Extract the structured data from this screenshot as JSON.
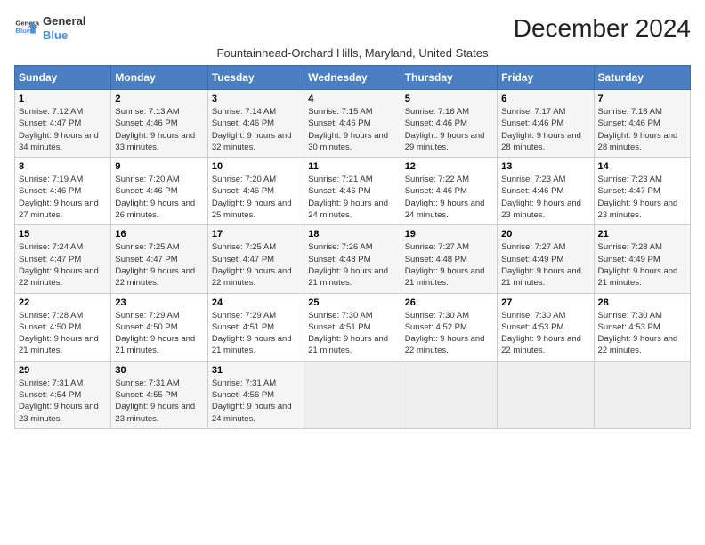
{
  "logo": {
    "line1": "General",
    "line2": "Blue",
    "icon_color": "#4a90d9"
  },
  "title": "December 2024",
  "subtitle": "Fountainhead-Orchard Hills, Maryland, United States",
  "columns": [
    "Sunday",
    "Monday",
    "Tuesday",
    "Wednesday",
    "Thursday",
    "Friday",
    "Saturday"
  ],
  "weeks": [
    [
      {
        "day": "1",
        "sunrise": "Sunrise: 7:12 AM",
        "sunset": "Sunset: 4:47 PM",
        "daylight": "Daylight: 9 hours and 34 minutes."
      },
      {
        "day": "2",
        "sunrise": "Sunrise: 7:13 AM",
        "sunset": "Sunset: 4:46 PM",
        "daylight": "Daylight: 9 hours and 33 minutes."
      },
      {
        "day": "3",
        "sunrise": "Sunrise: 7:14 AM",
        "sunset": "Sunset: 4:46 PM",
        "daylight": "Daylight: 9 hours and 32 minutes."
      },
      {
        "day": "4",
        "sunrise": "Sunrise: 7:15 AM",
        "sunset": "Sunset: 4:46 PM",
        "daylight": "Daylight: 9 hours and 30 minutes."
      },
      {
        "day": "5",
        "sunrise": "Sunrise: 7:16 AM",
        "sunset": "Sunset: 4:46 PM",
        "daylight": "Daylight: 9 hours and 29 minutes."
      },
      {
        "day": "6",
        "sunrise": "Sunrise: 7:17 AM",
        "sunset": "Sunset: 4:46 PM",
        "daylight": "Daylight: 9 hours and 28 minutes."
      },
      {
        "day": "7",
        "sunrise": "Sunrise: 7:18 AM",
        "sunset": "Sunset: 4:46 PM",
        "daylight": "Daylight: 9 hours and 28 minutes."
      }
    ],
    [
      {
        "day": "8",
        "sunrise": "Sunrise: 7:19 AM",
        "sunset": "Sunset: 4:46 PM",
        "daylight": "Daylight: 9 hours and 27 minutes."
      },
      {
        "day": "9",
        "sunrise": "Sunrise: 7:20 AM",
        "sunset": "Sunset: 4:46 PM",
        "daylight": "Daylight: 9 hours and 26 minutes."
      },
      {
        "day": "10",
        "sunrise": "Sunrise: 7:20 AM",
        "sunset": "Sunset: 4:46 PM",
        "daylight": "Daylight: 9 hours and 25 minutes."
      },
      {
        "day": "11",
        "sunrise": "Sunrise: 7:21 AM",
        "sunset": "Sunset: 4:46 PM",
        "daylight": "Daylight: 9 hours and 24 minutes."
      },
      {
        "day": "12",
        "sunrise": "Sunrise: 7:22 AM",
        "sunset": "Sunset: 4:46 PM",
        "daylight": "Daylight: 9 hours and 24 minutes."
      },
      {
        "day": "13",
        "sunrise": "Sunrise: 7:23 AM",
        "sunset": "Sunset: 4:46 PM",
        "daylight": "Daylight: 9 hours and 23 minutes."
      },
      {
        "day": "14",
        "sunrise": "Sunrise: 7:23 AM",
        "sunset": "Sunset: 4:47 PM",
        "daylight": "Daylight: 9 hours and 23 minutes."
      }
    ],
    [
      {
        "day": "15",
        "sunrise": "Sunrise: 7:24 AM",
        "sunset": "Sunset: 4:47 PM",
        "daylight": "Daylight: 9 hours and 22 minutes."
      },
      {
        "day": "16",
        "sunrise": "Sunrise: 7:25 AM",
        "sunset": "Sunset: 4:47 PM",
        "daylight": "Daylight: 9 hours and 22 minutes."
      },
      {
        "day": "17",
        "sunrise": "Sunrise: 7:25 AM",
        "sunset": "Sunset: 4:47 PM",
        "daylight": "Daylight: 9 hours and 22 minutes."
      },
      {
        "day": "18",
        "sunrise": "Sunrise: 7:26 AM",
        "sunset": "Sunset: 4:48 PM",
        "daylight": "Daylight: 9 hours and 21 minutes."
      },
      {
        "day": "19",
        "sunrise": "Sunrise: 7:27 AM",
        "sunset": "Sunset: 4:48 PM",
        "daylight": "Daylight: 9 hours and 21 minutes."
      },
      {
        "day": "20",
        "sunrise": "Sunrise: 7:27 AM",
        "sunset": "Sunset: 4:49 PM",
        "daylight": "Daylight: 9 hours and 21 minutes."
      },
      {
        "day": "21",
        "sunrise": "Sunrise: 7:28 AM",
        "sunset": "Sunset: 4:49 PM",
        "daylight": "Daylight: 9 hours and 21 minutes."
      }
    ],
    [
      {
        "day": "22",
        "sunrise": "Sunrise: 7:28 AM",
        "sunset": "Sunset: 4:50 PM",
        "daylight": "Daylight: 9 hours and 21 minutes."
      },
      {
        "day": "23",
        "sunrise": "Sunrise: 7:29 AM",
        "sunset": "Sunset: 4:50 PM",
        "daylight": "Daylight: 9 hours and 21 minutes."
      },
      {
        "day": "24",
        "sunrise": "Sunrise: 7:29 AM",
        "sunset": "Sunset: 4:51 PM",
        "daylight": "Daylight: 9 hours and 21 minutes."
      },
      {
        "day": "25",
        "sunrise": "Sunrise: 7:30 AM",
        "sunset": "Sunset: 4:51 PM",
        "daylight": "Daylight: 9 hours and 21 minutes."
      },
      {
        "day": "26",
        "sunrise": "Sunrise: 7:30 AM",
        "sunset": "Sunset: 4:52 PM",
        "daylight": "Daylight: 9 hours and 22 minutes."
      },
      {
        "day": "27",
        "sunrise": "Sunrise: 7:30 AM",
        "sunset": "Sunset: 4:53 PM",
        "daylight": "Daylight: 9 hours and 22 minutes."
      },
      {
        "day": "28",
        "sunrise": "Sunrise: 7:30 AM",
        "sunset": "Sunset: 4:53 PM",
        "daylight": "Daylight: 9 hours and 22 minutes."
      }
    ],
    [
      {
        "day": "29",
        "sunrise": "Sunrise: 7:31 AM",
        "sunset": "Sunset: 4:54 PM",
        "daylight": "Daylight: 9 hours and 23 minutes."
      },
      {
        "day": "30",
        "sunrise": "Sunrise: 7:31 AM",
        "sunset": "Sunset: 4:55 PM",
        "daylight": "Daylight: 9 hours and 23 minutes."
      },
      {
        "day": "31",
        "sunrise": "Sunrise: 7:31 AM",
        "sunset": "Sunset: 4:56 PM",
        "daylight": "Daylight: 9 hours and 24 minutes."
      },
      null,
      null,
      null,
      null
    ]
  ]
}
